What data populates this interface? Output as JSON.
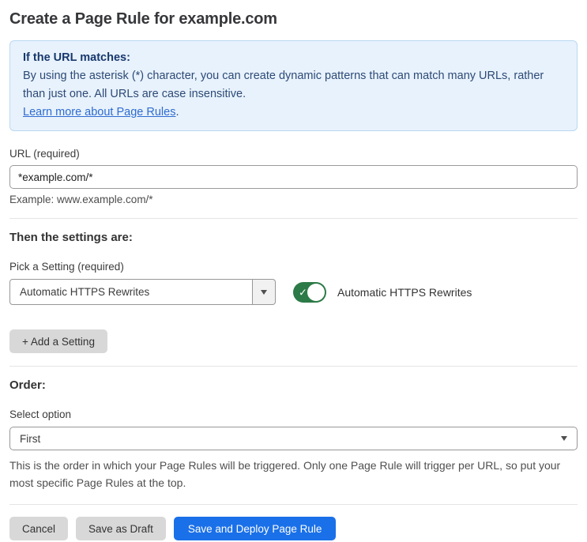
{
  "page": {
    "title": "Create a Page Rule for example.com"
  },
  "info_box": {
    "heading": "If the URL matches:",
    "body": "By using the asterisk (*) character, you can create dynamic patterns that can match many URLs, rather than just one. All URLs are case insensitive.",
    "link": "Learn more about Page Rules",
    "link_suffix": "."
  },
  "url_field": {
    "label": "URL (required)",
    "value": "*example.com/*",
    "helper": "Example: www.example.com/*"
  },
  "settings": {
    "heading": "Then the settings are:",
    "picker_label": "Pick a Setting (required)",
    "picker_value": "Automatic HTTPS Rewrites",
    "toggle_state": "on",
    "toggle_check_glyph": "✓",
    "toggle_label": "Automatic HTTPS Rewrites",
    "add_button": "+ Add a Setting"
  },
  "order": {
    "heading": "Order:",
    "label": "Select option",
    "value": "First",
    "helper": "This is the order in which your Page Rules will be triggered. Only one Page Rule will trigger per URL, so put your most specific Page Rules at the top."
  },
  "footer": {
    "cancel": "Cancel",
    "save_draft": "Save as Draft",
    "save_deploy": "Save and Deploy Page Rule"
  },
  "colors": {
    "primary_blue": "#1a70e8",
    "toggle_green": "#2c7a47",
    "info_background": "#e8f2fc",
    "info_border": "#b9d8f3",
    "info_heading_text": "#17386d",
    "info_body_text": "#2d4a77",
    "link_blue": "#2e6bd0",
    "gray_button_background": "#d8d8d8"
  }
}
